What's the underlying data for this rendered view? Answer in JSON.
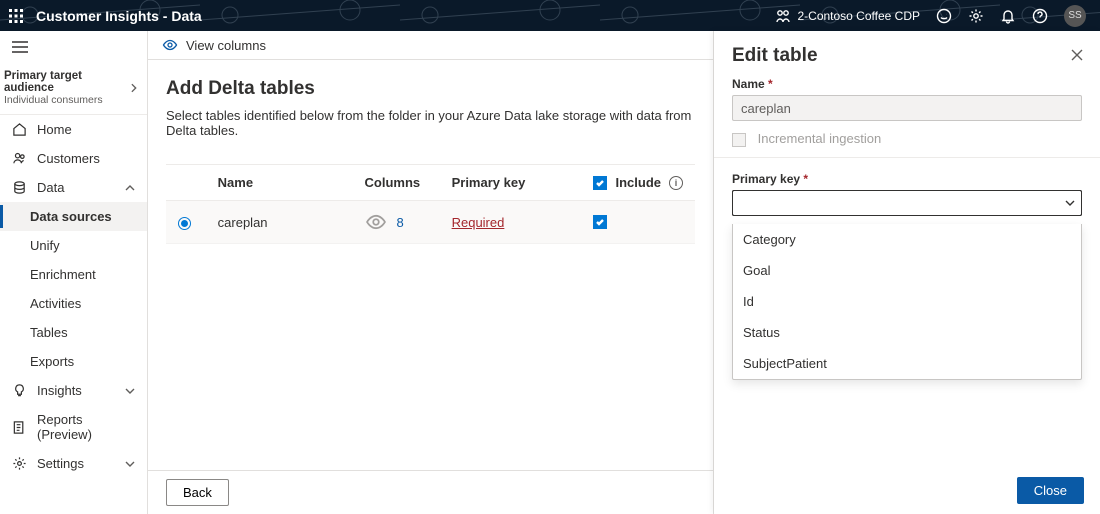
{
  "header": {
    "app_title": "Customer Insights - Data",
    "env_name": "2-Contoso Coffee CDP",
    "avatar": "SS"
  },
  "audience": {
    "title": "Primary target audience",
    "subtitle": "Individual consumers"
  },
  "nav": {
    "home": "Home",
    "customers": "Customers",
    "data": "Data",
    "data_sources": "Data sources",
    "unify": "Unify",
    "enrichment": "Enrichment",
    "activities": "Activities",
    "tables": "Tables",
    "exports": "Exports",
    "insights": "Insights",
    "reports": "Reports (Preview)",
    "settings": "Settings"
  },
  "toolbar": {
    "view_columns": "View columns"
  },
  "page": {
    "title": "Add Delta tables",
    "subtitle": "Select tables identified below from the folder in your Azure Data lake storage with data from Delta tables."
  },
  "table": {
    "headers": {
      "name": "Name",
      "columns": "Columns",
      "primary_key": "Primary key",
      "include": "Include"
    },
    "rows": [
      {
        "name": "careplan",
        "columns": "8",
        "primary_key": "Required"
      }
    ]
  },
  "footer": {
    "back": "Back"
  },
  "panel": {
    "title": "Edit table",
    "name_label": "Name",
    "name_value": "careplan",
    "incremental_label": "Incremental ingestion",
    "pk_label": "Primary key",
    "pk_value": "",
    "options": [
      "Category",
      "Goal",
      "Id",
      "Status",
      "SubjectPatient"
    ],
    "close": "Close"
  }
}
